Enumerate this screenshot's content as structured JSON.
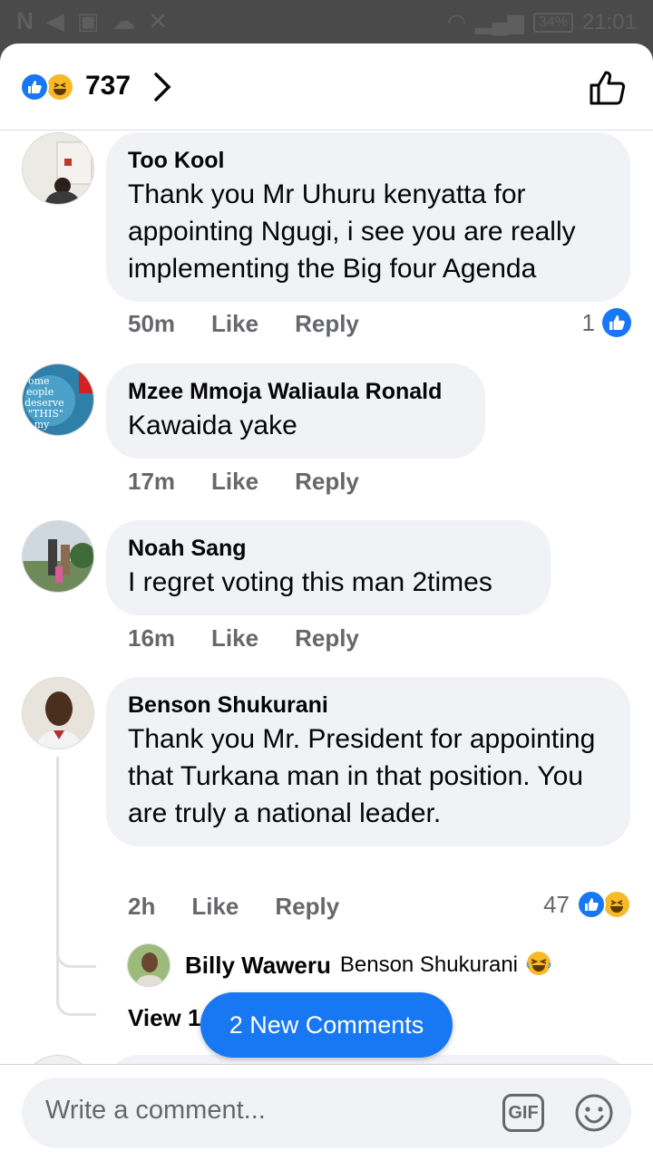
{
  "status_bar": {
    "battery": "34%",
    "time": "21:01"
  },
  "header": {
    "reaction_count": "737",
    "reaction_icons": [
      "like-icon",
      "haha-icon"
    ]
  },
  "comments": [
    {
      "author": "Too Kool",
      "text": "Thank you Mr Uhuru kenyatta for appointing Ngugi, i see you are really implementing the Big four Agenda",
      "time": "50m",
      "like_label": "Like",
      "reply_label": "Reply",
      "reaction_count": "1"
    },
    {
      "author": "Mzee Mmoja Waliaula Ronald",
      "text": "Kawaida yake",
      "time": "17m",
      "like_label": "Like",
      "reply_label": "Reply"
    },
    {
      "author": "Noah Sang",
      "text": "I regret voting this man 2times",
      "time": "16m",
      "like_label": "Like",
      "reply_label": "Reply"
    },
    {
      "author": "Benson Shukurani",
      "text": "Thank you Mr. President for appointing that Turkana man in that position. You are truly a national leader.",
      "time": "2h",
      "like_label": "Like",
      "reply_label": "Reply",
      "reaction_count": "47",
      "reply_preview": {
        "author": "Billy Waweru",
        "text": "Benson Shukurani"
      },
      "view_more_label": "View 1"
    }
  ],
  "new_comments_label": "2 New Comments",
  "composer": {
    "placeholder": "Write a comment...",
    "gif_label": "GIF"
  },
  "colors": {
    "accent": "#1877f2",
    "bubble": "#f0f2f5",
    "meta_text": "#65676b"
  }
}
